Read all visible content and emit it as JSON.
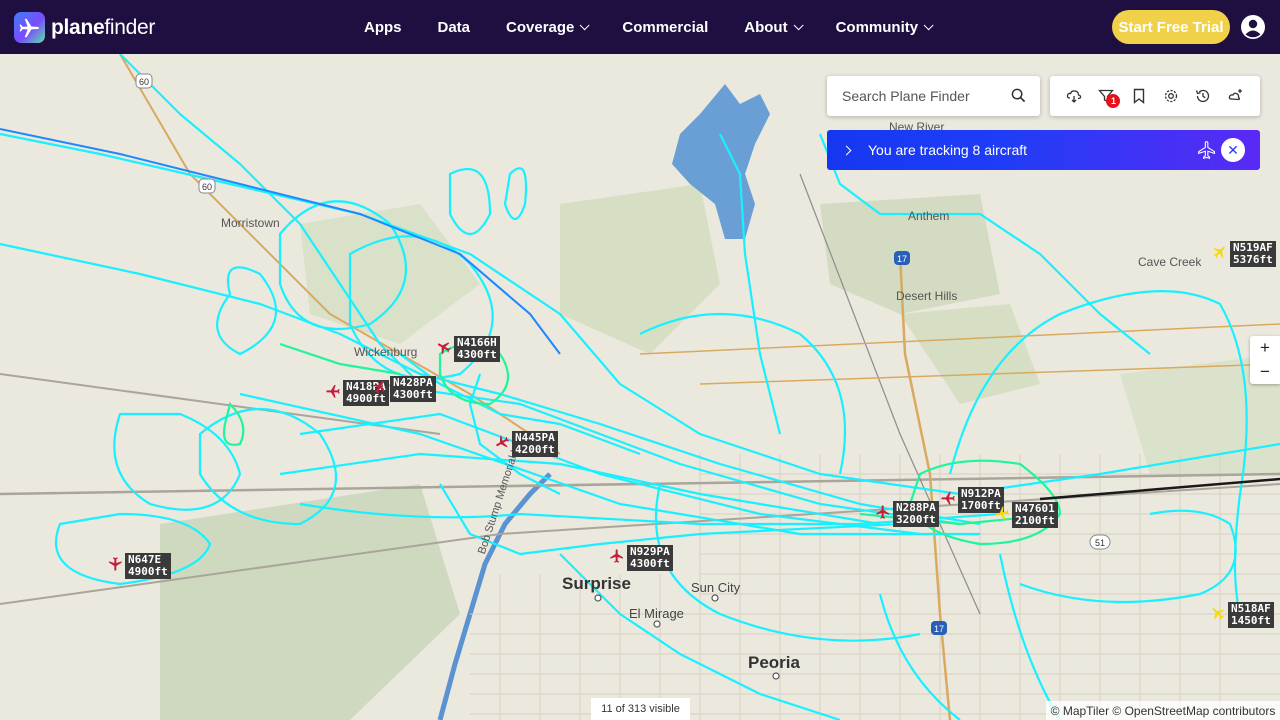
{
  "brand": {
    "name_bold": "plane",
    "name_rest": "finder"
  },
  "nav": [
    {
      "label": "Apps",
      "dropdown": false
    },
    {
      "label": "Data",
      "dropdown": false
    },
    {
      "label": "Coverage",
      "dropdown": true
    },
    {
      "label": "Commercial",
      "dropdown": false
    },
    {
      "label": "About",
      "dropdown": true
    },
    {
      "label": "Community",
      "dropdown": true
    }
  ],
  "trial_button": "Start Free Trial",
  "search": {
    "placeholder": "Search Plane Finder"
  },
  "toolbar": {
    "icons": [
      "weather-icon",
      "filter-icon",
      "bookmark-icon",
      "settings-icon",
      "history-icon",
      "clear-sky-icon"
    ],
    "filter_badge": "1"
  },
  "tracking": {
    "text": "You are tracking 8 aircraft"
  },
  "zoom": {
    "in": "+",
    "out": "−"
  },
  "places": [
    "Morristown",
    "Wickenburg",
    "New River",
    "Anthem",
    "Desert Hills",
    "Cave Creek",
    "Surprise",
    "Sun City",
    "El Mirage",
    "Peoria",
    "Bob Stump Memorial Hwy"
  ],
  "road_shields": [
    "60",
    "60",
    "17",
    "17",
    "51"
  ],
  "aircraft": [
    {
      "callsign": "N4166H",
      "altitude": "4300ft",
      "color": "#c41e3a"
    },
    {
      "callsign": "N418PA",
      "altitude": "4900ft",
      "color": "#c41e3a"
    },
    {
      "callsign": "N428PA",
      "altitude": "4300ft",
      "color": "#c41e3a"
    },
    {
      "callsign": "N445PA",
      "altitude": "4200ft",
      "color": "#c41e3a"
    },
    {
      "callsign": "N647E",
      "altitude": "4900ft",
      "color": "#c41e3a"
    },
    {
      "callsign": "N929PA",
      "altitude": "4300ft",
      "color": "#c41e3a"
    },
    {
      "callsign": "N288PA",
      "altitude": "3200ft",
      "color": "#c41e3a"
    },
    {
      "callsign": "N912PA",
      "altitude": "1700ft",
      "color": "#c41e3a"
    },
    {
      "callsign": "N47601",
      "altitude": "2100ft",
      "color": "#f5d90a"
    },
    {
      "callsign": "N519AF",
      "altitude": "5376ft",
      "color": "#f5d90a"
    },
    {
      "callsign": "N518AF",
      "altitude": "1450ft",
      "color": "#f5d90a"
    }
  ],
  "visible_count": "11 of 313 visible",
  "attribution": "© MapTiler © OpenStreetMap contributors",
  "colors": {
    "nav_bg": "#1e0f40",
    "trial_bg": "#f1d14a",
    "track_cyan": "#19f0ff",
    "track_green": "#1ff59a",
    "tracking_bar": "#1f3df6"
  }
}
